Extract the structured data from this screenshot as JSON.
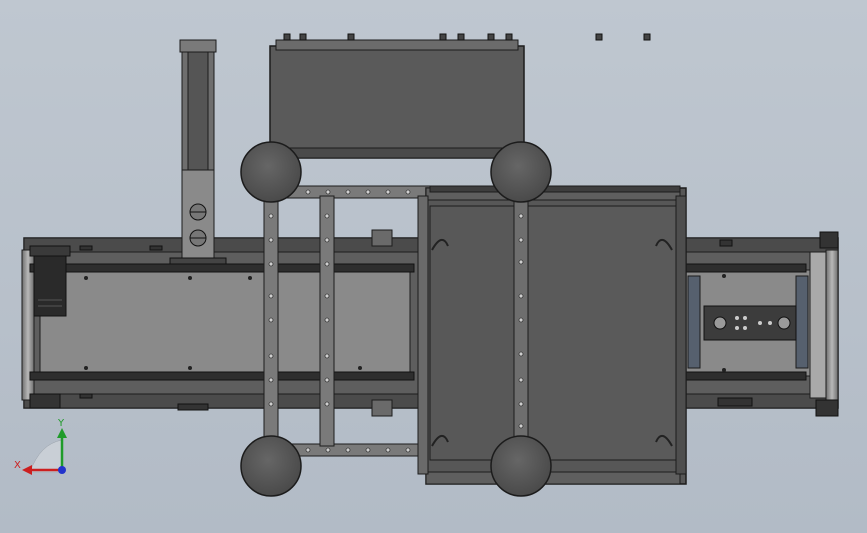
{
  "view": {
    "background_top": "#bfc7d0",
    "background_bottom": "#b2bbc6"
  },
  "triad": {
    "x_label": "X",
    "y_label": "Y",
    "x_color": "#cc1f1f",
    "y_color": "#1f9b2a",
    "z_color": "#2233cc"
  },
  "colors": {
    "body_dark": "#4a4a4a",
    "body_mid": "#5b5b5b",
    "panel_light": "#7c7c7c",
    "belt_gray": "#8a8a8a",
    "edge": "#1c1c1c",
    "roller": "#9a9a9a",
    "wheel": "#555555"
  }
}
